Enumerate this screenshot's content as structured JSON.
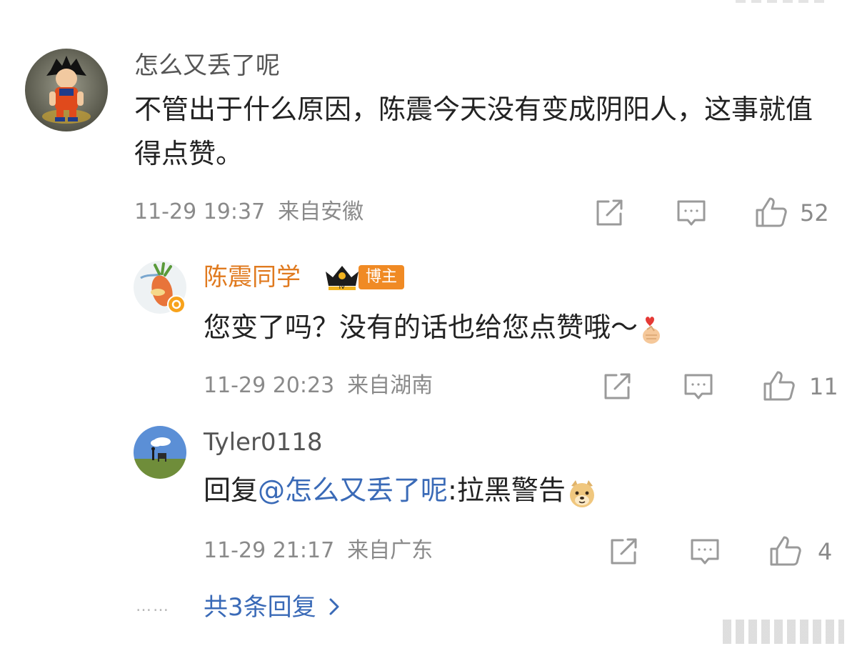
{
  "comments": [
    {
      "username": "怎么又丢了呢",
      "text": "不管出于什么原因，陈震今天没有变成阴阳人，这事就值得点赞。",
      "time": "11-29 19:37",
      "location": "来自安徽",
      "likes": "52",
      "avatar_icon": "cartoon-character-avatar"
    },
    {
      "username": "陈震同学",
      "badge_level": "Ⅳ",
      "badge_label": "博主",
      "text": "您变了吗？没有的话也给您点赞哦～",
      "emoji": "finger-heart-emoji",
      "time": "11-29 20:23",
      "location": "来自湖南",
      "likes": "11",
      "avatar_icon": "carrot-avatar"
    },
    {
      "username": "Tyler0118",
      "reply_prefix": "回复",
      "mention": "@怎么又丢了呢",
      "text": ":拉黑警告",
      "emoji": "doge-emoji",
      "time": "11-29 21:17",
      "location": "来自广东",
      "likes": "4",
      "avatar_icon": "landscape-avatar"
    }
  ],
  "more_replies": {
    "dots": "……",
    "label": "共3条回复",
    "chevron": "›"
  },
  "colors": {
    "accent_blue": "#3a6ab7",
    "blogger_orange": "#e07a1f",
    "meta_gray": "#8a8a8a"
  }
}
